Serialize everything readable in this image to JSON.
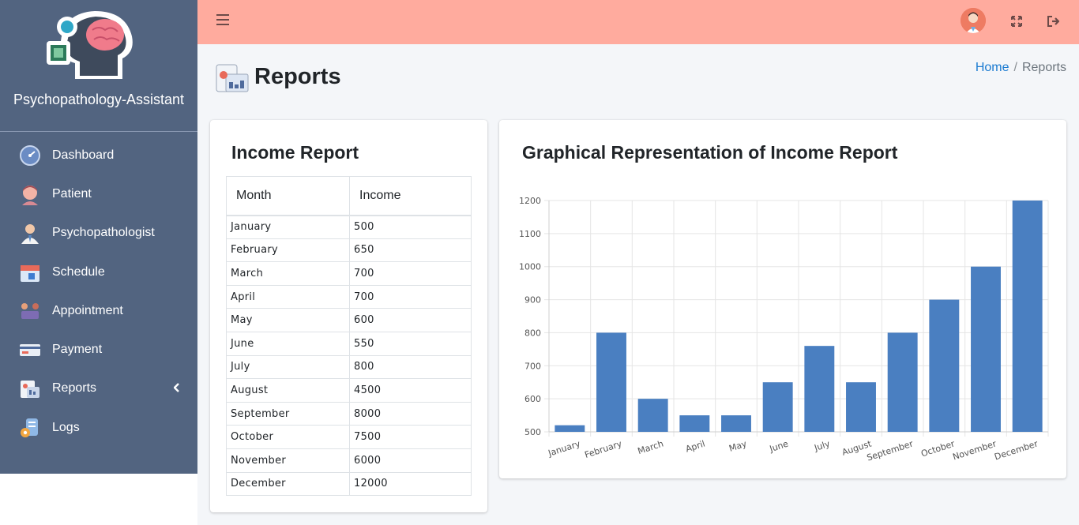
{
  "brand": {
    "name": "Psychopathology-Assistant"
  },
  "sidebar": {
    "items": [
      {
        "label": "Dashboard",
        "icon": "dashboard-gauge-icon"
      },
      {
        "label": "Patient",
        "icon": "patient-icon"
      },
      {
        "label": "Psychopathologist",
        "icon": "doctor-icon"
      },
      {
        "label": "Schedule",
        "icon": "calendar-icon"
      },
      {
        "label": "Appointment",
        "icon": "appointment-icon"
      },
      {
        "label": "Payment",
        "icon": "payment-card-icon"
      },
      {
        "label": "Reports",
        "icon": "reports-icon",
        "expandable": true
      },
      {
        "label": "Logs",
        "icon": "logs-gear-icon"
      }
    ]
  },
  "topbar": {
    "icons": [
      "menu-icon",
      "user-avatar",
      "fullscreen-icon",
      "logout-icon"
    ]
  },
  "header": {
    "title": "Reports",
    "breadcrumb": {
      "home": "Home",
      "separator": "/",
      "current": "Reports"
    }
  },
  "income_report": {
    "title": "Income Report",
    "columns": [
      "Month",
      "Income"
    ],
    "rows": [
      [
        "January",
        "500"
      ],
      [
        "February",
        "650"
      ],
      [
        "March",
        "700"
      ],
      [
        "April",
        "700"
      ],
      [
        "May",
        "600"
      ],
      [
        "June",
        "550"
      ],
      [
        "July",
        "800"
      ],
      [
        "August",
        "4500"
      ],
      [
        "September",
        "8000"
      ],
      [
        "October",
        "7500"
      ],
      [
        "November",
        "6000"
      ],
      [
        "December",
        "12000"
      ]
    ]
  },
  "chart_panel": {
    "title": "Graphical Representation of Income Report"
  },
  "colors": {
    "sidebar": "#526480",
    "topbar": "#ffab9e",
    "bar": "#4a7fc1",
    "link": "#1b7bd1"
  },
  "chart_data": {
    "type": "bar",
    "categories": [
      "January",
      "February",
      "March",
      "April",
      "May",
      "June",
      "July",
      "August",
      "September",
      "October",
      "November",
      "December"
    ],
    "values": [
      520,
      800,
      600,
      550,
      550,
      650,
      760,
      650,
      800,
      900,
      1000,
      1200
    ],
    "ylim": [
      500,
      1200
    ],
    "yticks": [
      500,
      600,
      700,
      800,
      900,
      1000,
      1100,
      1200
    ],
    "grid": true,
    "title": "",
    "xlabel": "",
    "ylabel": ""
  }
}
